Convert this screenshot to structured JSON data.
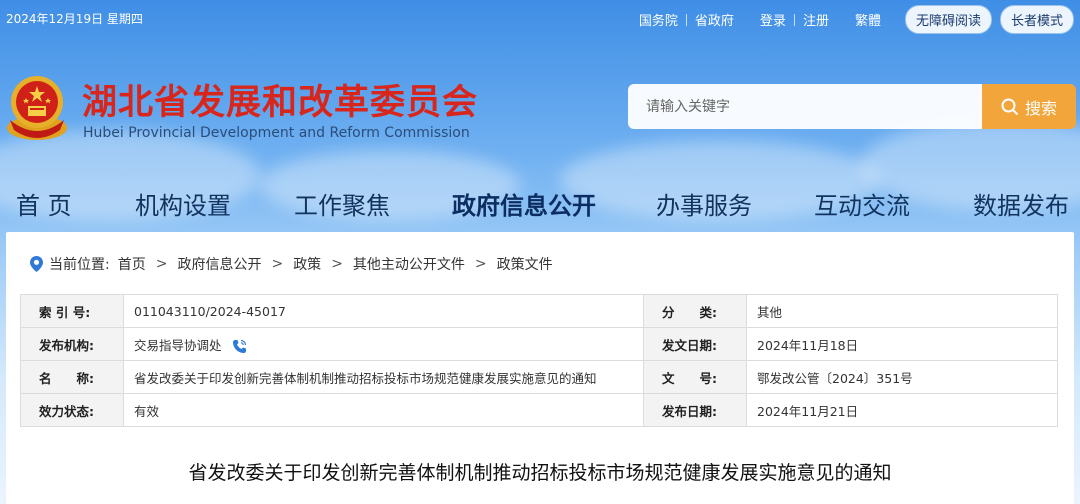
{
  "topbar": {
    "date": "2024年12月19日 星期四",
    "links": [
      "国务院",
      "省政府"
    ],
    "auth": [
      "登录",
      "注册"
    ],
    "traditional": "繁體",
    "accessibility": "无障碍阅读",
    "elderly": "长者模式"
  },
  "header": {
    "title": "湖北省发展和改革委员会",
    "subtitle": "Hubei Provincial Development and Reform Commission",
    "search_placeholder": "请输入关键字",
    "search_label": "搜索"
  },
  "nav": {
    "items": [
      "首 页",
      "机构设置",
      "工作聚焦",
      "政府信息公开",
      "办事服务",
      "互动交流",
      "数据发布"
    ],
    "active_index": 3
  },
  "breadcrumb": {
    "prefix": "当前位置:",
    "items": [
      "首页",
      "政府信息公开",
      "政策",
      "其他主动公开文件",
      "政策文件"
    ],
    "separator": ">"
  },
  "meta": {
    "index_label": "索 引 号:",
    "index_value": "011043110/2024-45017",
    "category_label": "分　　类:",
    "category_value": "其他",
    "publisher_label": "发布机构:",
    "publisher_value": "交易指导协调处",
    "issue_date_label": "发文日期:",
    "issue_date_value": "2024年11月18日",
    "name_label": "名　　称:",
    "name_value": "省发改委关于印发创新完善体制机制推动招标投标市场规范健康发展实施意见的通知",
    "doc_no_label": "文　　号:",
    "doc_no_value": "鄂发改公管〔2024〕351号",
    "status_label": "效力状态:",
    "status_value": "有效",
    "pub_date_label": "发布日期:",
    "pub_date_value": "2024年11月21日"
  },
  "document": {
    "title": "省发改委关于印发创新完善体制机制推动招标投标市场规范健康发展实施意见的通知"
  },
  "colors": {
    "title_red": "#d9261c",
    "search_orange": "#f2a53a",
    "nav_blue": "#12335e",
    "pin_blue": "#2e7ad6"
  }
}
